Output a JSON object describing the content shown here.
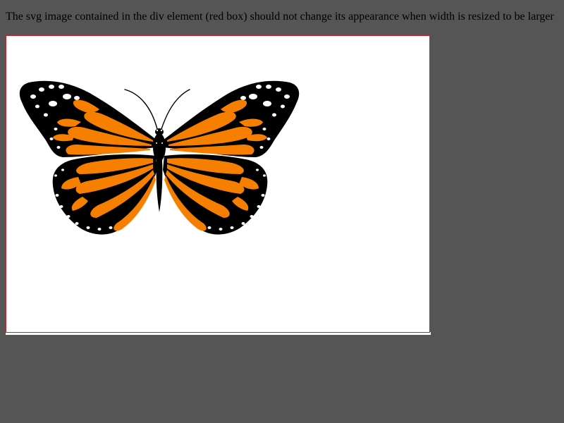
{
  "instruction": "The svg image contained in the div element (red box) should not change its appearance when width is resized to be larger",
  "colors": {
    "page_background": "#555555",
    "box_border": "#c0262c",
    "box_background": "#ffffff",
    "wing_orange": "#f77f00",
    "wing_black": "#000000",
    "spots": "#ffffff"
  },
  "image": {
    "subject": "butterfly-icon"
  }
}
